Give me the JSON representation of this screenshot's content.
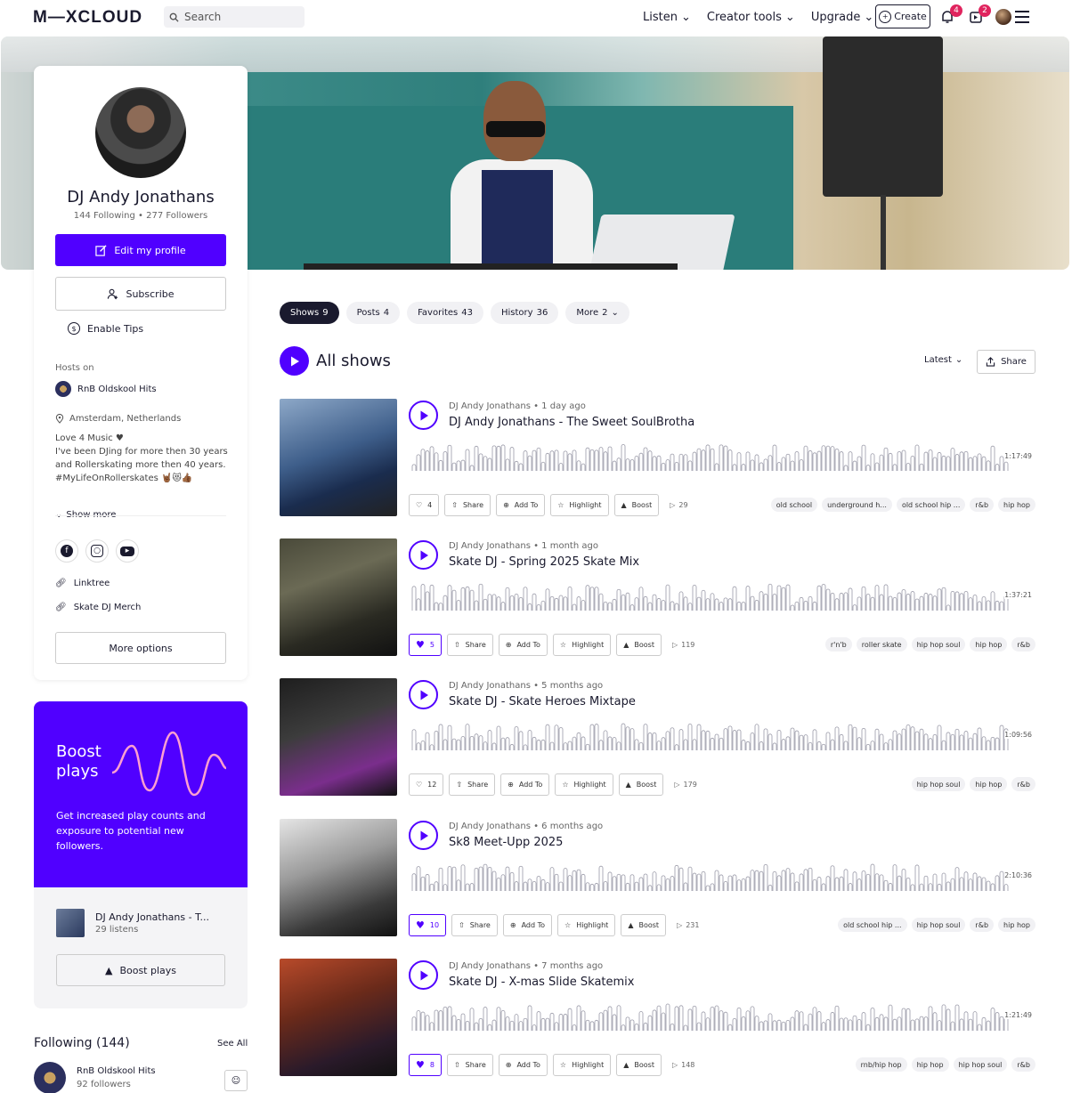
{
  "nav": {
    "logo": "M—XCLOUD",
    "search_placeholder": "Search",
    "links": [
      "Listen",
      "Creator tools",
      "Upgrade"
    ],
    "create_label": "Create",
    "notifications_count": "4",
    "uploads_count": "2"
  },
  "profile": {
    "name": "DJ Andy Jonathans",
    "stats": "144 Following  •  277 Followers",
    "edit_label": "Edit my profile",
    "subscribe_label": "Subscribe",
    "tips_label": "Enable Tips",
    "hosts_label": "Hosts on",
    "hosts_item": "RnB Oldskool Hits",
    "location": "Amsterdam, Netherlands",
    "bio": "Love 4 Music ♥\nI've been DJing for more then 30 years and Rollerskating more then 40 years. #MyLifeOnRollerskates 🤘🏾😻👍🏾",
    "show_more": "Show more",
    "links": [
      "Linktree",
      "Skate DJ Merch"
    ],
    "more_options": "More options"
  },
  "boost": {
    "title": "Boost\nplays",
    "description": "Get increased play counts and exposure to potential new followers.",
    "track_title": "DJ Andy Jonathans - T...",
    "track_sub": "29 listens",
    "button": "Boost plays"
  },
  "following": {
    "title": "Following (144)",
    "see_all": "See All",
    "item_name": "RnB Oldskool Hits",
    "item_sub": "92 followers"
  },
  "tabs": [
    {
      "label": "Shows",
      "count": "9"
    },
    {
      "label": "Posts",
      "count": "4"
    },
    {
      "label": "Favorites",
      "count": "43"
    },
    {
      "label": "History",
      "count": "36"
    },
    {
      "label": "More",
      "count": "2"
    }
  ],
  "main": {
    "title": "All shows",
    "sort": "Latest",
    "share": "Share"
  },
  "shows": [
    {
      "meta": "DJ Andy Jonathans  •  1 day ago",
      "title": "DJ Andy Jonathans - The Sweet SoulBrotha",
      "duration": "1:17:49",
      "likes": "4",
      "liked": false,
      "plays": "29",
      "tags": [
        "old school",
        "underground h...",
        "old school hip ...",
        "r&b",
        "hip hop"
      ]
    },
    {
      "meta": "DJ Andy Jonathans  •  1 month ago",
      "title": "Skate DJ - Spring 2025 Skate Mix",
      "duration": "1:37:21",
      "likes": "5",
      "liked": true,
      "plays": "119",
      "tags": [
        "r'n'b",
        "roller skate",
        "hip hop soul",
        "hip hop",
        "r&b"
      ]
    },
    {
      "meta": "DJ Andy Jonathans  •  5 months ago",
      "title": "Skate DJ - Skate Heroes Mixtape",
      "duration": "1:09:56",
      "likes": "12",
      "liked": false,
      "plays": "179",
      "tags": [
        "hip hop soul",
        "hip hop",
        "r&b"
      ]
    },
    {
      "meta": "DJ Andy Jonathans  •  6 months ago",
      "title": "Sk8 Meet-Upp 2025",
      "duration": "2:10:36",
      "likes": "10",
      "liked": true,
      "plays": "231",
      "tags": [
        "old school hip ...",
        "hip hop soul",
        "r&b",
        "hip hop"
      ]
    },
    {
      "meta": "DJ Andy Jonathans  •  7 months ago",
      "title": "Skate DJ - X-mas Slide Skatemix",
      "duration": "1:21:49",
      "likes": "8",
      "liked": true,
      "plays": "148",
      "tags": [
        "rnb/hip hop",
        "hip hop",
        "hip hop soul",
        "r&b"
      ]
    }
  ],
  "action_labels": {
    "share": "Share",
    "add_to": "Add To",
    "highlight": "Highlight",
    "boost": "Boost"
  },
  "colors": {
    "accent": "#5000ff",
    "dark": "#1a1a2e",
    "badge": "#e0245e"
  }
}
